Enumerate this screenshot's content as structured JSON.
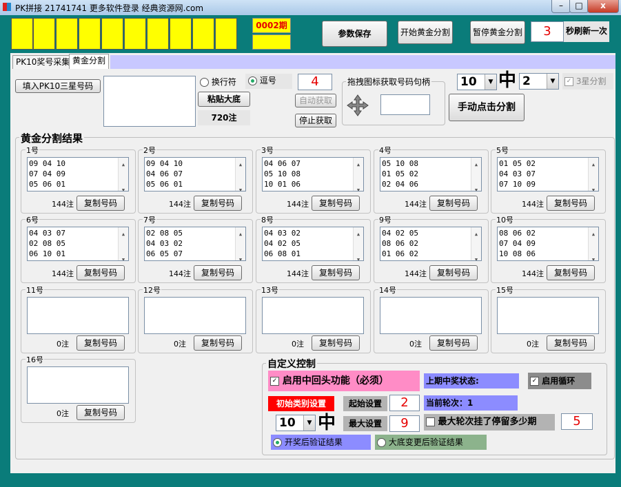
{
  "window": {
    "title": "PK拼接 21741741 更多软件登录 经典资源网.com",
    "minimize": "–",
    "maximize": "□",
    "close": "x"
  },
  "top": {
    "period": "0002期",
    "save_btn": "参数保存",
    "start_btn": "开始黄金分割",
    "pause_btn": "暂停黄金分割",
    "refresh_value": "3",
    "refresh_label": "秒刷新一次"
  },
  "tabs": [
    "PK10奖号采集",
    "黄金分割"
  ],
  "controls": {
    "fill_btn": "填入PK10三星号码",
    "radio_newline": "换行符",
    "radio_comma": "逗号",
    "paste_btn": "粘贴大底",
    "count_label": "720注",
    "auto_value": "4",
    "auto_btn": "自动获取",
    "stop_btn": "停止获取",
    "drag_group": "拖拽图标获取号码句柄",
    "num_select": "10",
    "zhong": "中",
    "hit_select": "2",
    "three_star": "3星分割",
    "manual_btn": "手动点击分割"
  },
  "results": {
    "title": "黄金分割结果",
    "copy_label": "复制号码",
    "cards": [
      {
        "label": "1号",
        "lines": [
          "09 04 10",
          "07 04 09",
          "05 06 01"
        ],
        "count": "144注"
      },
      {
        "label": "2号",
        "lines": [
          "09 04 10",
          "04 06 07",
          "05 06 01"
        ],
        "count": "144注"
      },
      {
        "label": "3号",
        "lines": [
          "04 06 07",
          "05 10 08",
          "10 01 06"
        ],
        "count": "144注"
      },
      {
        "label": "4号",
        "lines": [
          "05 10 08",
          "01 05 02",
          "02 04 06"
        ],
        "count": "144注"
      },
      {
        "label": "5号",
        "lines": [
          "01 05 02",
          "04 03 07",
          "07 10 09"
        ],
        "count": "144注"
      },
      {
        "label": "6号",
        "lines": [
          "04 03 07",
          "02 08 05",
          "06 10 01"
        ],
        "count": "144注"
      },
      {
        "label": "7号",
        "lines": [
          "02 08 05",
          "04 03 02",
          "06 05 07"
        ],
        "count": "144注"
      },
      {
        "label": "8号",
        "lines": [
          "04 03 02",
          "04 02 05",
          "06 08 01"
        ],
        "count": "144注"
      },
      {
        "label": "9号",
        "lines": [
          "04 02 05",
          "08 06 02",
          "01 06 02"
        ],
        "count": "144注"
      },
      {
        "label": "10号",
        "lines": [
          "08 06 02",
          "07 04 09",
          "10 08 06"
        ],
        "count": "144注"
      },
      {
        "label": "11号",
        "lines": [],
        "count": "0注"
      },
      {
        "label": "12号",
        "lines": [],
        "count": "0注"
      },
      {
        "label": "13号",
        "lines": [],
        "count": "0注"
      },
      {
        "label": "14号",
        "lines": [],
        "count": "0注"
      },
      {
        "label": "15号",
        "lines": [],
        "count": "0注"
      },
      {
        "label": "16号",
        "lines": [],
        "count": "0注"
      }
    ]
  },
  "custom": {
    "title": "自定义控制",
    "enable_return": "启用中回头功能（必须）",
    "last_status": "上期中奖状态:",
    "enable_loop": "启用循环",
    "init_type": "初始类别设置",
    "start_setting": "起始设置",
    "start_value": "2",
    "current_round": "当前轮次：1",
    "num_select": "10",
    "zhong": "中",
    "max_setting": "最大设置",
    "max_value": "9",
    "max_round_label": "最大轮次挂了停留多少期",
    "max_round_value": "5",
    "verify_after": "开奖后验证结果",
    "verify_change": "大底变更后验证结果"
  }
}
